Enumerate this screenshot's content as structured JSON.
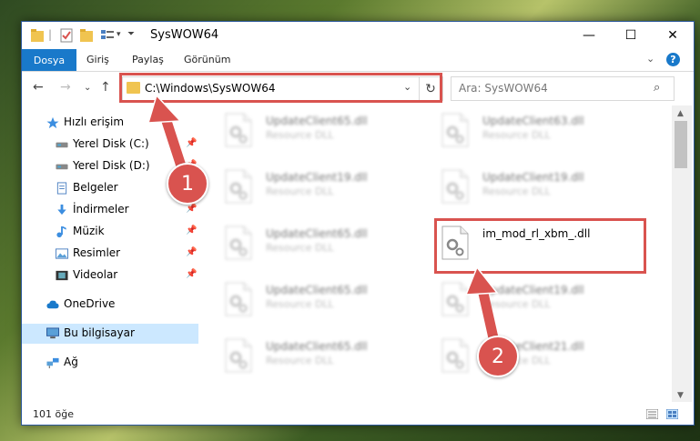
{
  "window": {
    "title": "SysWOW64",
    "controls": {
      "minimize": "—",
      "maximize": "☐",
      "close": "✕"
    }
  },
  "ribbon": {
    "tabs": [
      "Dosya",
      "Giriş",
      "Paylaş",
      "Görünüm"
    ],
    "expand": "⌄",
    "help": "?"
  },
  "nav": {
    "back": "←",
    "forward": "→",
    "recent": "⌄",
    "up": "↑",
    "address": "C:\\Windows\\SysWOW64",
    "address_dropdown": "⌄",
    "refresh": "↻",
    "search_placeholder": "Ara: SysWOW64"
  },
  "sidebar": {
    "items": [
      {
        "label": "Hızlı erişim",
        "icon": "star-icon",
        "pinned": false
      },
      {
        "label": "Yerel Disk (C:)",
        "icon": "drive-icon",
        "pinned": true
      },
      {
        "label": "Yerel Disk (D:)",
        "icon": "drive-icon",
        "pinned": true
      },
      {
        "label": "Belgeler",
        "icon": "document-icon",
        "pinned": true
      },
      {
        "label": "İndirmeler",
        "icon": "download-icon",
        "pinned": true
      },
      {
        "label": "Müzik",
        "icon": "music-icon",
        "pinned": true
      },
      {
        "label": "Resimler",
        "icon": "picture-icon",
        "pinned": true
      },
      {
        "label": "Videolar",
        "icon": "video-icon",
        "pinned": true
      },
      {
        "label": "OneDrive",
        "icon": "cloud-icon",
        "pinned": false
      },
      {
        "label": "Bu bilgisayar",
        "icon": "computer-icon",
        "pinned": false,
        "selected": true
      },
      {
        "label": "Ağ",
        "icon": "network-icon",
        "pinned": false
      }
    ]
  },
  "files": [
    {
      "name": "UpdateClient65.dll",
      "type": "Resource DLL",
      "blurred": true
    },
    {
      "name": "UpdateClient63.dll",
      "type": "Resource DLL",
      "blurred": true
    },
    {
      "name": "UpdateClient19.dll",
      "type": "Resource DLL",
      "blurred": true
    },
    {
      "name": "UpdateClient19.dll",
      "type": "Resource DLL",
      "blurred": true
    },
    {
      "name": "UpdateClient65.dll",
      "type": "Resource DLL",
      "blurred": true
    },
    {
      "name": "im_mod_rl_xbm_.dll",
      "type": "",
      "blurred": false
    },
    {
      "name": "UpdateClient65.dll",
      "type": "Resource DLL",
      "blurred": true
    },
    {
      "name": "UpdateClient19.dll",
      "type": "Resource DLL",
      "blurred": true
    },
    {
      "name": "UpdateClient65.dll",
      "type": "Resource DLL",
      "blurred": true
    },
    {
      "name": "UpdateClient21.dll",
      "type": "Resource DLL",
      "blurred": true
    }
  ],
  "status": {
    "count": "101 öğe"
  },
  "callouts": [
    {
      "number": "1"
    },
    {
      "number": "2"
    }
  ],
  "colors": {
    "accent": "#1979ca",
    "highlight": "#d9534f",
    "selected": "#cce8ff"
  }
}
